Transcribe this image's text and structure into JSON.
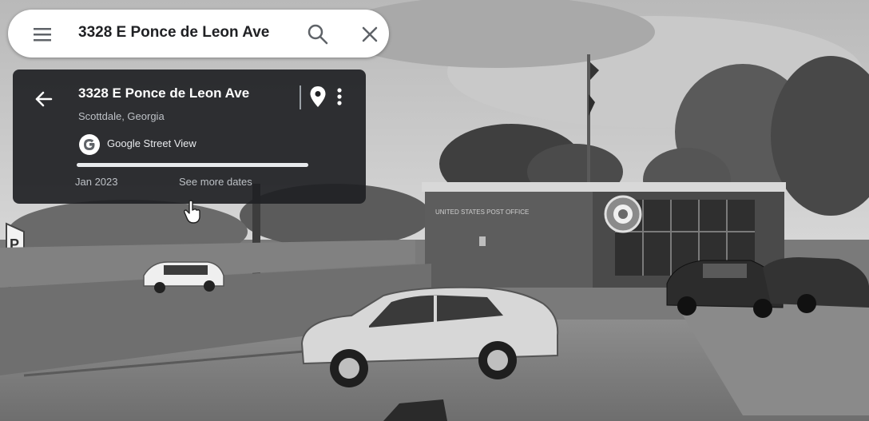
{
  "search": {
    "query": "3328 E Ponce de Leon Ave",
    "menu_icon": "hamburger-menu-icon",
    "search_icon": "search-icon",
    "close_icon": "close-icon"
  },
  "info_card": {
    "title": "3328 E Ponce de Leon Ave",
    "subtitle": "Scottdale, Georgia",
    "source": "Google Street View",
    "date": "Jan 2023",
    "see_more": "See more dates",
    "timeline_position": 1.0,
    "icons": [
      "back-arrow-icon",
      "location-pin-icon",
      "more-vert-icon",
      "google-g-icon"
    ]
  },
  "scene": {
    "description_icons": [
      "parking-sign-icon",
      "usps-eagle-logo-icon",
      "hand-cursor-icon"
    ],
    "building_sign_text": "UNITED STATES POST OFFICE"
  },
  "colors": {
    "card_bg": "#202124",
    "search_bg": "#ffffff",
    "text_dark": "#202124",
    "text_light": "#e8eaed",
    "text_muted": "#bdc1c6"
  }
}
